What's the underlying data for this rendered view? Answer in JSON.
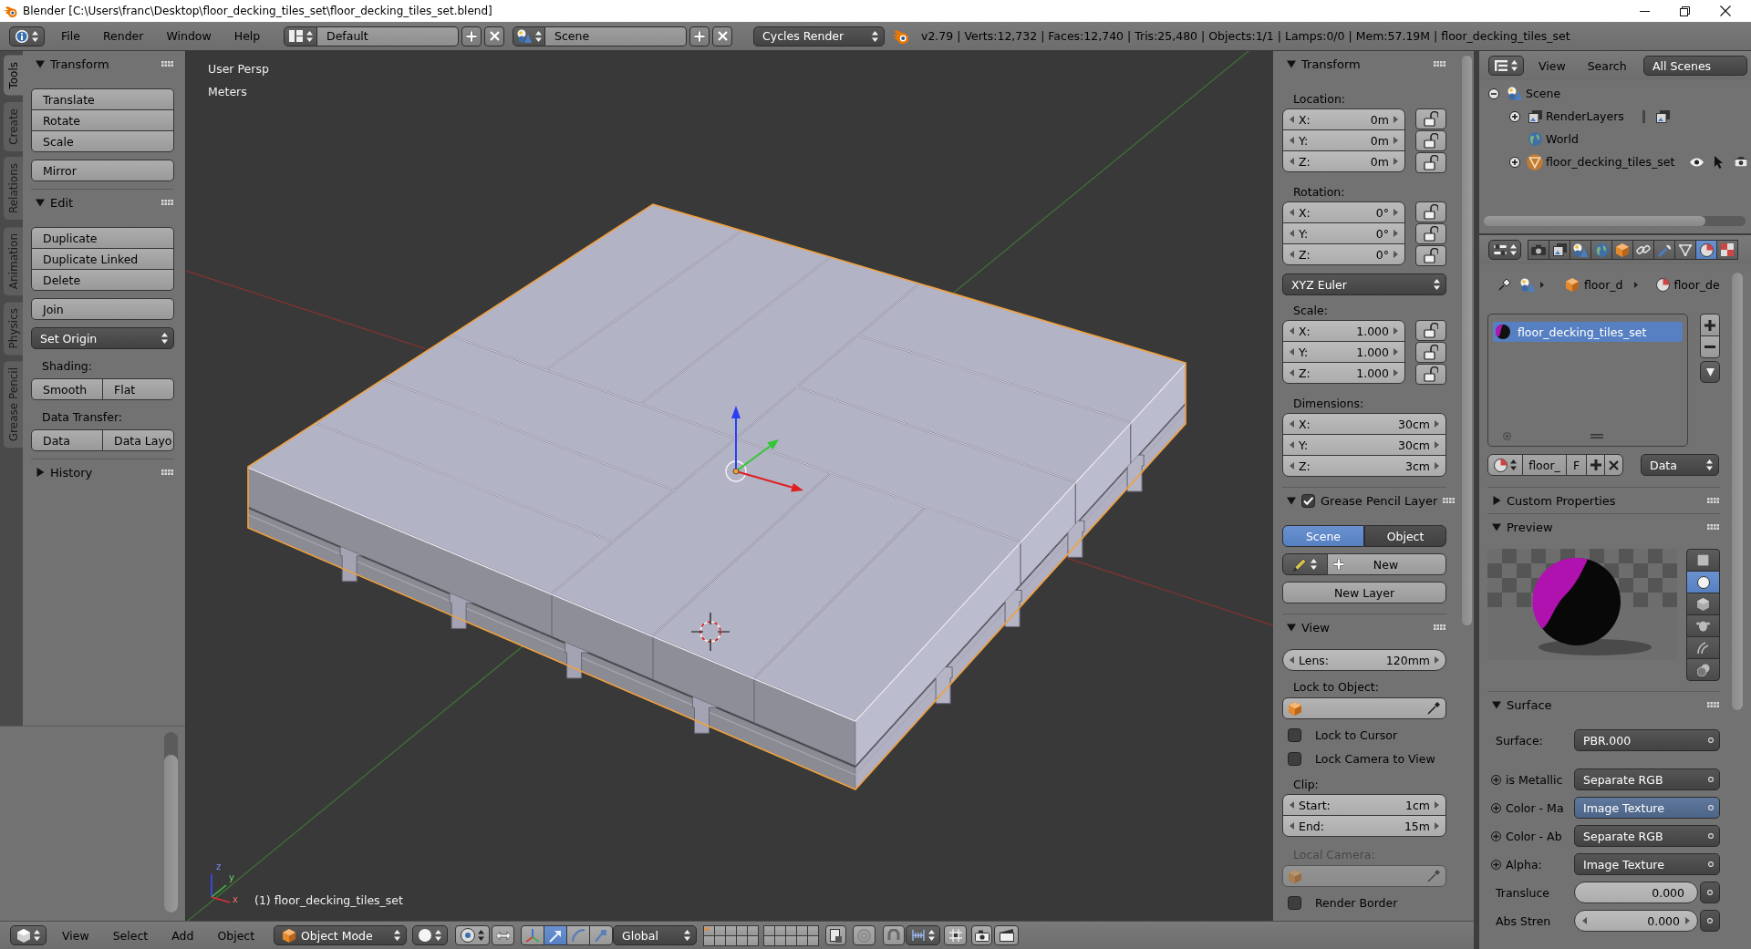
{
  "title_bar": {
    "title": "Blender [C:\\Users\\franc\\Desktop\\floor_decking_tiles_set\\floor_decking_tiles_set.blend]"
  },
  "top_header": {
    "menus": [
      "File",
      "Render",
      "Window",
      "Help"
    ],
    "screen_layout": "Default",
    "scene": "Scene",
    "render_engine": "Cycles Render",
    "stats": "v2.79 | Verts:12,732 | Faces:12,740 | Tris:25,480 | Objects:1/1 | Lamps:0/0 | Mem:57.19M | floor_decking_tiles_set"
  },
  "tool_tabs": [
    {
      "label": "Tools",
      "selected": true
    },
    {
      "label": "Create",
      "selected": false
    },
    {
      "label": "Relations",
      "selected": false
    },
    {
      "label": "Animation",
      "selected": false
    },
    {
      "label": "Physics",
      "selected": false
    },
    {
      "label": "Grease Pencil",
      "selected": false
    }
  ],
  "tool_shelf": [
    {
      "title": "Transform",
      "expanded": true,
      "items": [
        {
          "kind": "column",
          "buttons": [
            "Translate",
            "Rotate",
            "Scale"
          ]
        },
        {
          "kind": "column",
          "buttons": [
            "Mirror"
          ]
        }
      ]
    },
    {
      "title": "Edit",
      "expanded": true,
      "items": [
        {
          "kind": "column",
          "buttons": [
            "Duplicate",
            "Duplicate Linked",
            "Delete"
          ]
        },
        {
          "kind": "column",
          "buttons": [
            "Join"
          ]
        },
        {
          "kind": "menu",
          "label": "Set Origin"
        },
        {
          "kind": "label",
          "text": "Shading:"
        },
        {
          "kind": "row",
          "buttons": [
            "Smooth",
            "Flat"
          ]
        },
        {
          "kind": "label",
          "text": "Data Transfer:"
        },
        {
          "kind": "row",
          "buttons": [
            "Data",
            "Data Layo"
          ]
        }
      ]
    },
    {
      "title": "History",
      "expanded": false
    }
  ],
  "viewport": {
    "view_name": "User Persp",
    "units": "Meters",
    "axis_labels": [
      "z",
      "y",
      "x"
    ],
    "object_label": "(1) floor_decking_tiles_set"
  },
  "properties_shelf": [
    {
      "title": "Transform",
      "expanded": true,
      "items": [
        {
          "kind": "label",
          "text": "Location:",
          "disabled": false
        },
        {
          "kind": "vector",
          "fields": [
            {
              "axis": "X:",
              "value": "0m",
              "locked": false
            },
            {
              "axis": "Y:",
              "value": "0m",
              "locked": false
            },
            {
              "axis": "Z:",
              "value": "0m",
              "locked": false
            }
          ]
        },
        {
          "kind": "label",
          "text": "Rotation:",
          "disabled": false
        },
        {
          "kind": "vector",
          "fields": [
            {
              "axis": "X:",
              "value": "0°",
              "locked": false
            },
            {
              "axis": "Y:",
              "value": "0°",
              "locked": false
            },
            {
              "axis": "Z:",
              "value": "0°",
              "locked": false
            }
          ]
        },
        {
          "kind": "menu",
          "label": "XYZ Euler"
        },
        {
          "kind": "label",
          "text": "Scale:",
          "disabled": false
        },
        {
          "kind": "vector",
          "fields": [
            {
              "axis": "X:",
              "value": "1.000",
              "locked": false
            },
            {
              "axis": "Y:",
              "value": "1.000",
              "locked": false
            },
            {
              "axis": "Z:",
              "value": "1.000",
              "locked": false
            }
          ]
        },
        {
          "kind": "label",
          "text": "Dimensions:",
          "disabled": false
        },
        {
          "kind": "vector",
          "fields": [
            {
              "axis": "X:",
              "value": "30cm"
            },
            {
              "axis": "Y:",
              "value": "30cm"
            },
            {
              "axis": "Z:",
              "value": "3cm"
            }
          ]
        }
      ]
    },
    {
      "title": "Grease Pencil Layer",
      "expanded": true,
      "checked": true,
      "items": [
        {
          "kind": "segmented",
          "options": [
            {
              "label": "Scene",
              "selected": true
            },
            {
              "label": "Object",
              "selected": false
            }
          ]
        },
        {
          "kind": "new_row",
          "label": "New"
        },
        {
          "kind": "button",
          "label": "New Layer"
        }
      ]
    },
    {
      "title": "View",
      "expanded": true,
      "items": [
        {
          "kind": "number",
          "label": "Lens:",
          "value": "120mm"
        },
        {
          "kind": "label",
          "text": "Lock to Object:",
          "disabled": false
        },
        {
          "kind": "object_field",
          "disabled": false
        },
        {
          "kind": "checkbox",
          "label": "Lock to Cursor",
          "checked": false
        },
        {
          "kind": "checkbox",
          "label": "Lock Camera to View",
          "checked": false
        },
        {
          "kind": "label",
          "text": "Clip:",
          "disabled": false
        },
        {
          "kind": "vector",
          "fields": [
            {
              "axis": "Start:",
              "value": "1cm"
            },
            {
              "axis": "End:",
              "value": "15m"
            }
          ]
        },
        {
          "kind": "label",
          "text": "Local Camera:",
          "disabled": true
        },
        {
          "kind": "object_field",
          "disabled": true
        },
        {
          "kind": "checkbox",
          "label": "Render Border",
          "checked": false
        }
      ]
    }
  ],
  "outliner": {
    "menus": [
      "View",
      "Search"
    ],
    "filter": "All Scenes",
    "tree": [
      {
        "label": "Scene",
        "kind": "scene",
        "expanded": true,
        "children": [
          {
            "label": "RenderLayers",
            "kind": "render_layers",
            "expanded": false
          },
          {
            "label": "World",
            "kind": "world"
          },
          {
            "label": "floor_decking_tiles_set",
            "kind": "mesh_object",
            "expanded": false
          }
        ]
      }
    ]
  },
  "properties_editor": {
    "tabs": [
      {
        "kind": "render",
        "selected": false
      },
      {
        "kind": "render_layers",
        "selected": false
      },
      {
        "kind": "scene",
        "selected": false
      },
      {
        "kind": "world",
        "selected": false
      },
      {
        "kind": "object",
        "selected": false
      },
      {
        "kind": "constraints",
        "selected": false
      },
      {
        "kind": "modifiers",
        "selected": false
      },
      {
        "kind": "data",
        "selected": false
      },
      {
        "kind": "material",
        "selected": true
      },
      {
        "kind": "texture",
        "selected": false
      }
    ],
    "breadcrumb": [
      "floor_d",
      "floor_de"
    ],
    "material_slots": [
      {
        "name": "floor_decking_tiles_set",
        "selected": true
      }
    ],
    "datablock": {
      "name": "floor_",
      "fake_user": "F",
      "link": "Data"
    },
    "panels": [
      {
        "title": "Custom Properties",
        "expanded": false
      },
      {
        "kind": "preview",
        "title": "Preview",
        "expanded": true,
        "preview_types": [
          {
            "kind": "flat",
            "selected": false
          },
          {
            "kind": "sphere",
            "selected": true
          },
          {
            "kind": "cube",
            "selected": false
          },
          {
            "kind": "monkey",
            "selected": false
          },
          {
            "kind": "hair",
            "selected": false
          },
          {
            "kind": "sphere_sky",
            "selected": false
          }
        ]
      },
      {
        "kind": "surface",
        "title": "Surface",
        "expanded": true,
        "rows": [
          {
            "kind": "node",
            "label": "Surface:",
            "value": "PBR.000",
            "socket": false,
            "highlighted": false
          },
          {
            "kind": "node",
            "label": "is Metallic",
            "value": "Separate RGB",
            "socket": true,
            "highlighted": false
          },
          {
            "kind": "node",
            "label": "Color - Ma",
            "value": "Image Texture",
            "socket": true,
            "highlighted": true
          },
          {
            "kind": "node",
            "label": "Color - Ab",
            "value": "Separate RGB",
            "socket": true,
            "highlighted": false
          },
          {
            "kind": "node",
            "label": "Alpha:",
            "value": "Image Texture",
            "socket": true,
            "highlighted": false
          },
          {
            "kind": "slider",
            "label": "Transluce",
            "value": "0.000",
            "socket": false
          },
          {
            "kind": "number",
            "label": "Abs Stren",
            "value": "0.000",
            "socket": false
          }
        ]
      }
    ]
  },
  "bottom_header": {
    "menus": [
      "View",
      "Select",
      "Add",
      "Object"
    ],
    "mode": "Object Mode",
    "orientation": "Global",
    "manipulators": [
      {
        "kind": "toggle",
        "selected": false
      },
      {
        "kind": "translate",
        "selected": true
      },
      {
        "kind": "rotate",
        "selected": false
      },
      {
        "kind": "scale",
        "selected": false
      }
    ],
    "layers": [
      {
        "used": true
      },
      {
        "used": false
      },
      {
        "used": false
      },
      {
        "used": false
      },
      {
        "used": false
      },
      {
        "used": false
      },
      {
        "used": false
      },
      {
        "used": false
      },
      {
        "used": false
      },
      {
        "used": false
      },
      {
        "used": false
      },
      {
        "used": false
      },
      {
        "used": false
      },
      {
        "used": false
      },
      {
        "used": false
      },
      {
        "used": false
      },
      {
        "used": false
      },
      {
        "used": false
      },
      {
        "used": false
      },
      {
        "used": false
      }
    ]
  }
}
